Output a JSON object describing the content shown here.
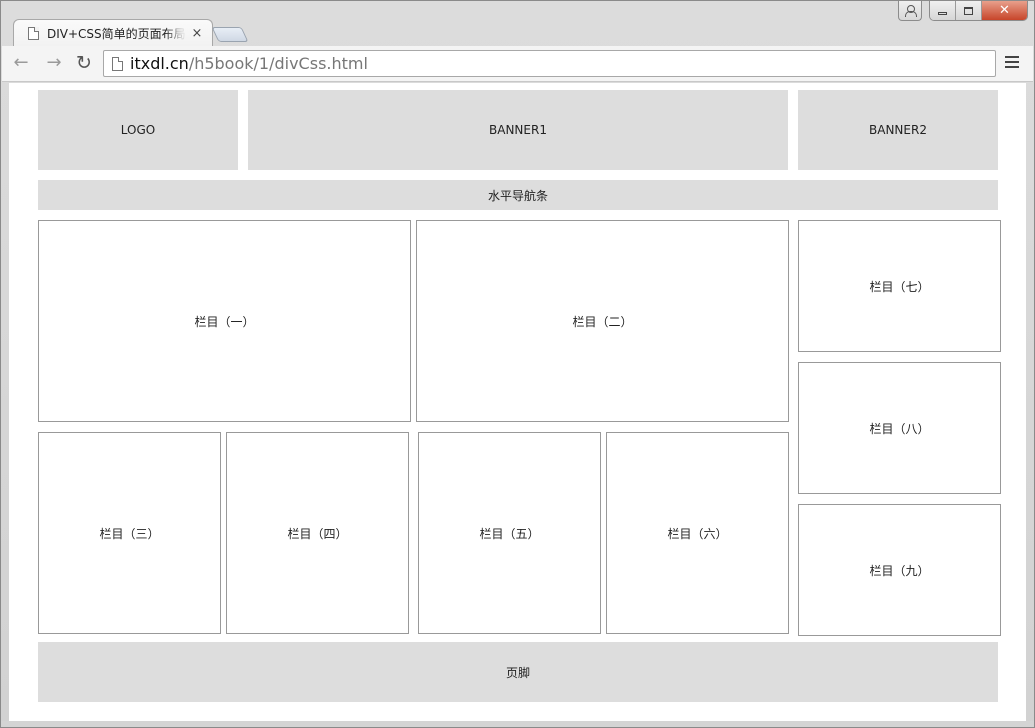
{
  "browser": {
    "tab_title": "DIV+CSS简单的页面布局",
    "tab_close_glyph": "×",
    "url_host": "itxdl.cn",
    "url_path": "/h5book/1/divCss.html",
    "back_glyph": "←",
    "forward_glyph": "→",
    "reload_glyph": "↻",
    "close_glyph": "✕",
    "icons": [
      "doc-icon",
      "user-icon",
      "minimize-icon",
      "maximize-icon",
      "close-icon",
      "back-icon",
      "forward-icon",
      "reload-icon",
      "page-icon",
      "menu-icon"
    ]
  },
  "page": {
    "logo": "LOGO",
    "banner1": "BANNER1",
    "banner2": "BANNER2",
    "nav": "水平导航条",
    "col1": "栏目（一）",
    "col2": "栏目（二）",
    "col3": "栏目（三）",
    "col4": "栏目（四）",
    "col5": "栏目（五）",
    "col6": "栏目（六）",
    "col7": "栏目（七）",
    "col8": "栏目（八）",
    "col9": "栏目（九）",
    "footer": "页脚"
  },
  "colors": {
    "gray_block": "#dddddd",
    "outline": "#999999"
  }
}
